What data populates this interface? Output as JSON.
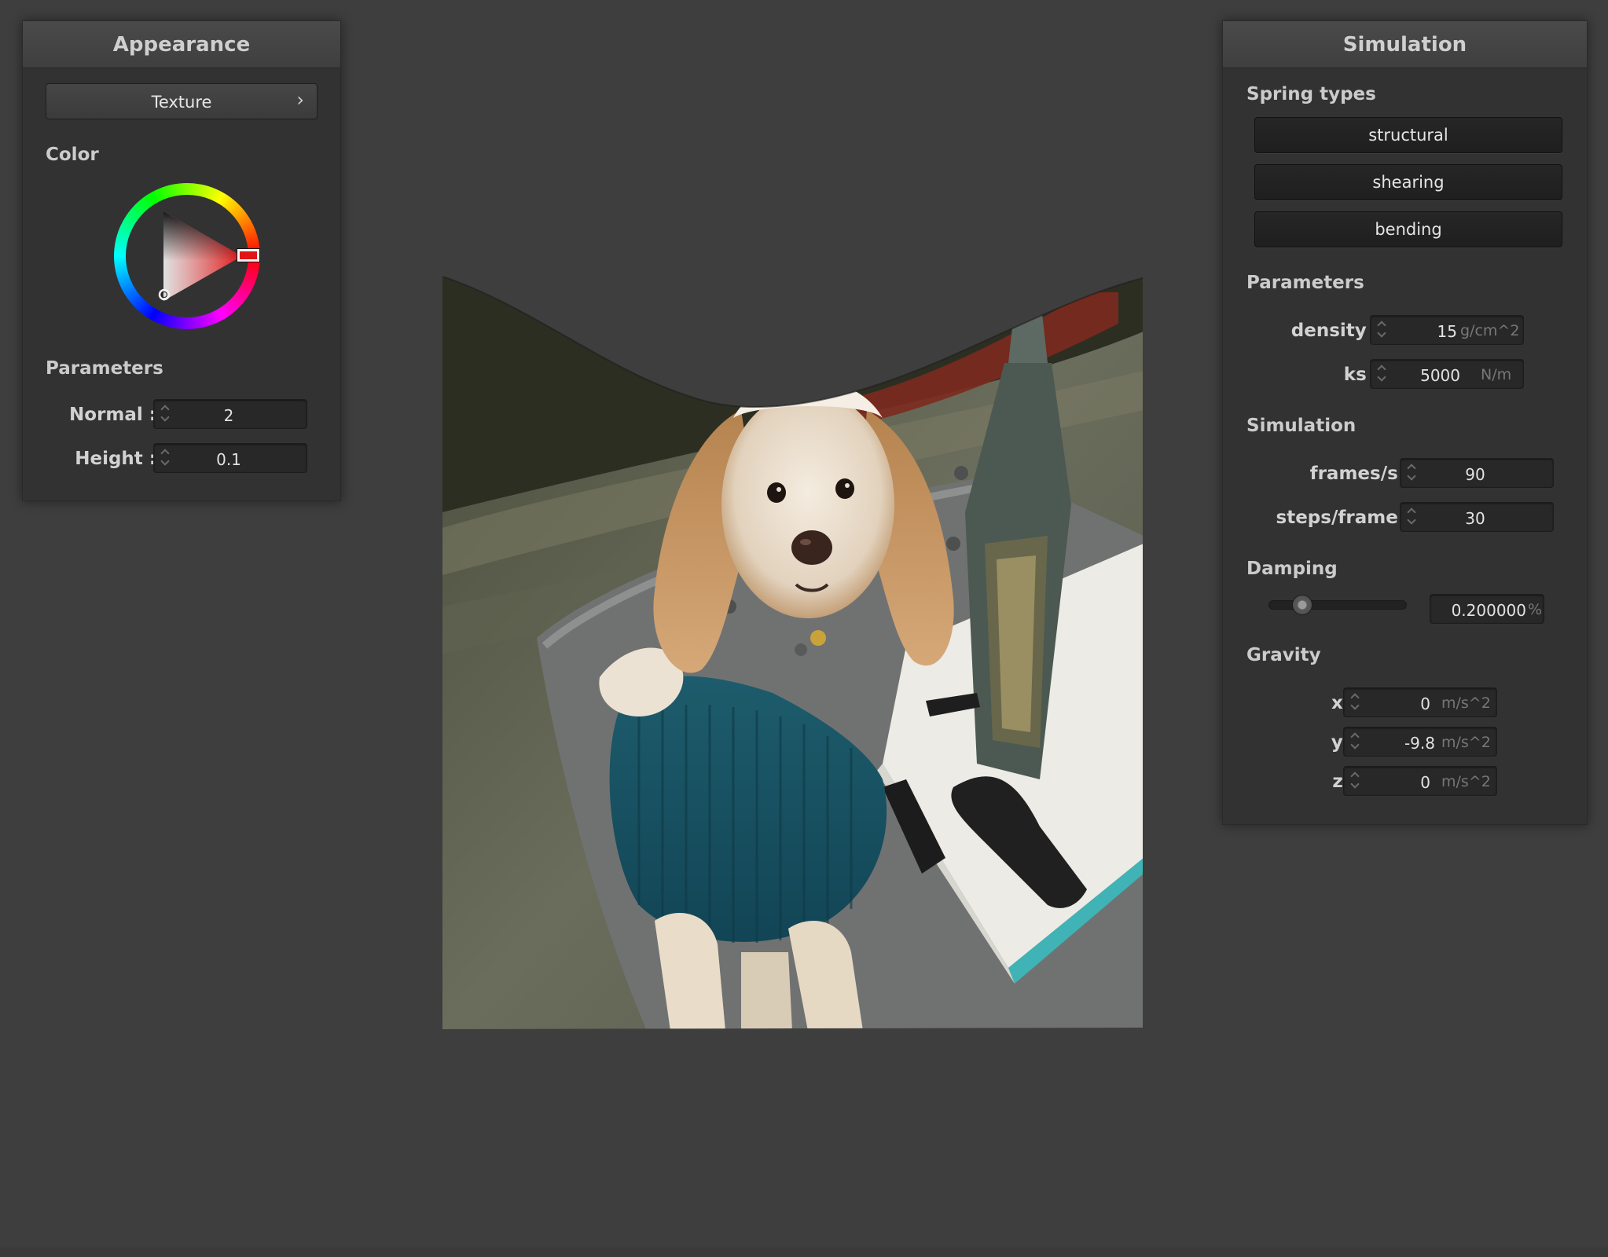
{
  "appearance": {
    "title": "Appearance",
    "texture_button": "Texture",
    "texture_chevron": "›",
    "color_label": "Color",
    "selected_color": "#e01616",
    "parameters_label": "Parameters",
    "normal": {
      "label": "Normal :",
      "value": "2"
    },
    "height": {
      "label": "Height :",
      "value": "0.1"
    }
  },
  "simulation": {
    "title": "Simulation",
    "spring_types_label": "Spring types",
    "spring_buttons": [
      "structural",
      "shearing",
      "bending"
    ],
    "parameters_label": "Parameters",
    "density": {
      "label": "density :",
      "value": "15",
      "unit": "g/cm^2"
    },
    "ks": {
      "label": "ks :",
      "value": "5000",
      "unit": "N/m"
    },
    "simulation_label": "Simulation",
    "frames_per_s": {
      "label": "frames/s :",
      "value": "90"
    },
    "steps_per_frame": {
      "label": "steps/frame :",
      "value": "30"
    },
    "damping_label": "Damping",
    "damping": {
      "value": "0.200000",
      "unit": "%",
      "slider_fraction": 0.2
    },
    "gravity_label": "Gravity",
    "gravity": {
      "x": {
        "label": "x :",
        "value": "0",
        "unit": "m/s^2"
      },
      "y": {
        "label": "y :",
        "value": "-9.8",
        "unit": "m/s^2"
      },
      "z": {
        "label": "z :",
        "value": "0",
        "unit": "m/s^2"
      }
    }
  },
  "canvas": {
    "content": "cloth-texture-dog-photo"
  },
  "colors": {
    "background": "#3e3e3e",
    "panel": "#323232",
    "accent_red": "#e01616"
  }
}
